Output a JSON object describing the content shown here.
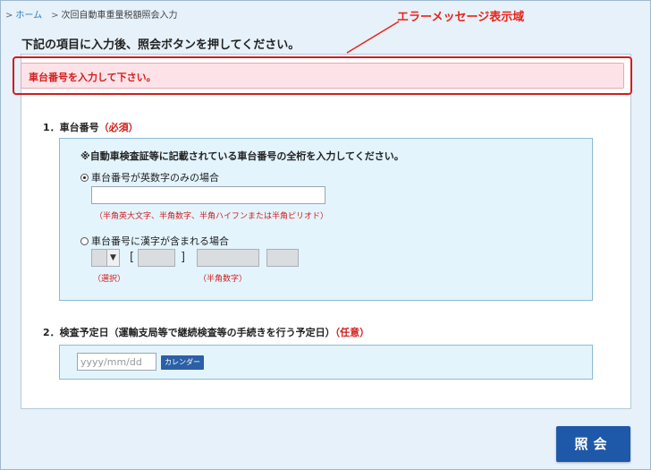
{
  "breadcrumb": {
    "home": "ホーム",
    "current": "次回自動車重量税額照会入力"
  },
  "annotation": {
    "label": "エラーメッセージ表示域"
  },
  "heading": "下記の項目に入力後、照会ボタンを押してください。",
  "error": {
    "message": "車台番号を入力して下さい。"
  },
  "section1": {
    "title": "1．車台番号",
    "required": "（必須）",
    "note": "※自動車検査証等に記載されている車台番号の全桁を入力してください。",
    "option_alnum": "車台番号が英数字のみの場合",
    "alnum_hint": "（半角英大文字、半角数字、半角ハイフンまたは半角ピリオド）",
    "alnum_value": "",
    "option_kanji": "車台番号に漢字が含まれる場合",
    "select_hint": "（選択）",
    "number_hint": "（半角数字）",
    "bracket_open": "[",
    "bracket_close": "]"
  },
  "section2": {
    "title": "2．検査予定日（運輸支局等で継続検査等の手続きを行う予定日）",
    "optional": "（任意）",
    "date_placeholder": "yyyy/mm/dd",
    "calendar_label": "カレンダー"
  },
  "submit_label": "照会",
  "colors": {
    "accent": "#1e58a8",
    "error": "#d41c1c",
    "error_bg": "#fde3e8",
    "box_bg": "#e3f4fd",
    "page_bg": "#e6f1f9"
  }
}
